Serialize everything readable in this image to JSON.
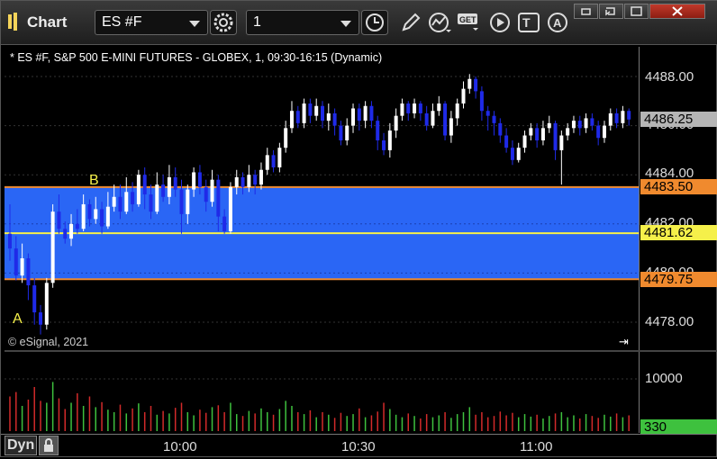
{
  "window": {
    "title": "Chart"
  },
  "toolbar": {
    "symbol": "ES #F",
    "interval": "1",
    "icons": [
      "settings-icon",
      "clock-icon",
      "pen-icon",
      "study-icon",
      "get-icon",
      "play-icon",
      "text-icon",
      "alert-icon"
    ]
  },
  "window_controls": [
    "restore-icon",
    "link-icon",
    "maximize-icon",
    "close-icon"
  ],
  "chart": {
    "title": "* ES #F, S&P 500 E-MINI FUTURES - GLOBEX, 1, 09:30-16:15 (Dynamic)",
    "copyright": "© eSignal, 2021",
    "annotations": {
      "a": "A",
      "b": "B"
    }
  },
  "chart_data": {
    "type": "candlestick",
    "y_ticks": [
      "4488.00",
      "4486.00",
      "4484.00",
      "4482.00",
      "4480.00",
      "4478.00"
    ],
    "price_labels": {
      "last": "4486.25",
      "upper": "4483.50",
      "mid": "4481.62",
      "lower": "4479.75"
    },
    "zone": {
      "upper": 4483.5,
      "lower": 4479.75,
      "mid": 4481.62
    },
    "volume_ticks": [
      "10000"
    ],
    "volume_last": "330",
    "x_ticks": [
      "10:00",
      "10:30",
      "11:00"
    ],
    "candles": [
      [
        4481.6,
        4481.0,
        4482.8,
        4480.5
      ],
      [
        4481.0,
        4479.9,
        4481.5,
        4479.7
      ],
      [
        4479.9,
        4480.6,
        4481.2,
        4479.6
      ],
      [
        4480.6,
        4479.5,
        4480.8,
        4478.9
      ],
      [
        4479.5,
        4478.4,
        4479.8,
        4477.9
      ],
      [
        4478.4,
        4477.9,
        4478.7,
        4477.5
      ],
      [
        4477.9,
        4479.6,
        4479.8,
        4477.7
      ],
      [
        4479.6,
        4482.5,
        4482.8,
        4479.4
      ],
      [
        4482.5,
        4481.8,
        4483.2,
        4481.6
      ],
      [
        4481.8,
        4481.4,
        4482.1,
        4481.2
      ],
      [
        4481.4,
        4482.0,
        4482.4,
        4481.1
      ],
      [
        4482.0,
        4481.8,
        4482.6,
        4481.6
      ],
      [
        4481.8,
        4482.8,
        4483.2,
        4481.7
      ],
      [
        4482.8,
        4482.2,
        4483.0,
        4481.9
      ],
      [
        4482.2,
        4482.6,
        4483.1,
        4482.0
      ],
      [
        4482.6,
        4481.9,
        4482.9,
        4481.6
      ],
      [
        4481.9,
        4482.7,
        4483.3,
        4481.8
      ],
      [
        4482.7,
        4483.1,
        4483.6,
        4482.5
      ],
      [
        4483.1,
        4482.5,
        4483.6,
        4482.2
      ],
      [
        4482.5,
        4483.3,
        4483.9,
        4482.4
      ],
      [
        4483.3,
        4482.8,
        4483.7,
        4482.5
      ],
      [
        4482.8,
        4484.0,
        4484.2,
        4482.7
      ],
      [
        4484.0,
        4483.2,
        4484.3,
        4482.6
      ],
      [
        4483.2,
        4482.5,
        4483.6,
        4482.2
      ],
      [
        4482.5,
        4483.6,
        4484.1,
        4482.4
      ],
      [
        4483.6,
        4483.1,
        4484.0,
        4482.9
      ],
      [
        4483.1,
        4483.9,
        4484.4,
        4482.8
      ],
      [
        4483.9,
        4483.4,
        4484.3,
        4483.1
      ],
      [
        4483.4,
        4482.4,
        4483.8,
        4481.6
      ],
      [
        4482.4,
        4483.4,
        4483.6,
        4482.0
      ],
      [
        4483.4,
        4484.1,
        4484.3,
        4483.1
      ],
      [
        4484.1,
        4483.5,
        4484.4,
        4483.2
      ],
      [
        4483.5,
        4482.9,
        4483.8,
        4482.5
      ],
      [
        4482.9,
        4483.8,
        4484.2,
        4482.7
      ],
      [
        4483.8,
        4482.3,
        4484.0,
        4481.7
      ],
      [
        4482.3,
        4481.7,
        4482.6,
        4481.6
      ],
      [
        4481.7,
        4483.5,
        4483.7,
        4481.6
      ],
      [
        4483.5,
        4483.9,
        4484.2,
        4483.2
      ],
      [
        4483.9,
        4483.5,
        4484.1,
        4483.2
      ],
      [
        4483.5,
        4484.0,
        4484.4,
        4483.3
      ],
      [
        4484.0,
        4483.6,
        4484.2,
        4483.2
      ],
      [
        4483.6,
        4484.2,
        4484.5,
        4483.4
      ],
      [
        4484.2,
        4484.8,
        4485.1,
        4484.0
      ],
      [
        4484.8,
        4484.3,
        4485.0,
        4484.1
      ],
      [
        4484.3,
        4485.1,
        4485.3,
        4484.1
      ],
      [
        4485.1,
        4485.9,
        4486.2,
        4484.9
      ],
      [
        4485.9,
        4486.6,
        4487.0,
        4485.7
      ],
      [
        4486.6,
        4486.1,
        4486.8,
        4485.9
      ],
      [
        4486.1,
        4486.9,
        4487.1,
        4485.9
      ],
      [
        4486.9,
        4486.4,
        4487.1,
        4486.1
      ],
      [
        4486.4,
        4486.8,
        4487.1,
        4486.2
      ],
      [
        4486.8,
        4486.2,
        4487.0,
        4485.9
      ],
      [
        4486.2,
        4486.5,
        4486.9,
        4485.8
      ],
      [
        4486.5,
        4486.0,
        4486.7,
        4485.6
      ],
      [
        4486.0,
        4485.4,
        4486.2,
        4485.2
      ],
      [
        4485.4,
        4486.0,
        4486.3,
        4485.2
      ],
      [
        4486.0,
        4486.7,
        4486.9,
        4485.7
      ],
      [
        4486.7,
        4486.2,
        4486.9,
        4485.8
      ],
      [
        4486.2,
        4486.8,
        4487.0,
        4485.9
      ],
      [
        4486.8,
        4486.2,
        4487.0,
        4485.9
      ],
      [
        4486.2,
        4485.4,
        4486.4,
        4485.0
      ],
      [
        4485.4,
        4485.0,
        4485.7,
        4484.8
      ],
      [
        4485.0,
        4485.8,
        4486.1,
        4484.7
      ],
      [
        4485.8,
        4486.4,
        4486.7,
        4485.5
      ],
      [
        4486.4,
        4486.9,
        4487.1,
        4486.2
      ],
      [
        4486.9,
        4486.5,
        4487.0,
        4486.2
      ],
      [
        4486.5,
        4486.9,
        4487.1,
        4486.3
      ],
      [
        4486.9,
        4486.5,
        4487.0,
        4486.2
      ],
      [
        4486.5,
        4486.0,
        4486.8,
        4485.8
      ],
      [
        4486.0,
        4486.6,
        4486.9,
        4485.9
      ],
      [
        4486.6,
        4486.9,
        4487.2,
        4486.4
      ],
      [
        4486.9,
        4485.6,
        4487.0,
        4485.4
      ],
      [
        4485.6,
        4486.3,
        4486.6,
        4485.3
      ],
      [
        4486.3,
        4486.9,
        4487.1,
        4486.0
      ],
      [
        4486.9,
        4487.5,
        4487.8,
        4486.7
      ],
      [
        4487.5,
        4487.9,
        4488.1,
        4487.3
      ],
      [
        4487.9,
        4487.4,
        4488.0,
        4487.1
      ],
      [
        4487.4,
        4486.6,
        4487.6,
        4486.2
      ],
      [
        4486.6,
        4486.4,
        4486.8,
        4485.8
      ],
      [
        4486.4,
        4486.1,
        4486.6,
        4485.6
      ],
      [
        4486.1,
        4485.6,
        4486.3,
        4485.3
      ],
      [
        4485.6,
        4485.1,
        4485.9,
        4484.9
      ],
      [
        4485.1,
        4484.6,
        4485.4,
        4484.4
      ],
      [
        4484.6,
        4485.1,
        4485.3,
        4484.5
      ],
      [
        4485.1,
        4485.6,
        4485.8,
        4484.9
      ],
      [
        4485.6,
        4485.9,
        4486.1,
        4485.4
      ],
      [
        4485.9,
        4485.4,
        4486.1,
        4485.1
      ],
      [
        4485.4,
        4485.9,
        4486.2,
        4485.2
      ],
      [
        4485.9,
        4486.1,
        4486.4,
        4485.7
      ],
      [
        4486.1,
        4485.0,
        4486.2,
        4484.6
      ],
      [
        4485.0,
        4485.6,
        4485.8,
        4483.6
      ],
      [
        4485.6,
        4485.9,
        4486.1,
        4485.4
      ],
      [
        4485.9,
        4486.2,
        4486.4,
        4485.7
      ],
      [
        4486.2,
        4485.9,
        4486.4,
        4485.6
      ],
      [
        4485.9,
        4486.3,
        4486.5,
        4485.7
      ],
      [
        4486.3,
        4486.0,
        4486.5,
        4485.8
      ],
      [
        4486.0,
        4485.5,
        4486.2,
        4485.2
      ],
      [
        4485.5,
        4486.0,
        4486.2,
        4485.3
      ],
      [
        4486.0,
        4486.5,
        4486.7,
        4485.8
      ],
      [
        4486.5,
        4486.1,
        4486.7,
        4485.9
      ],
      [
        4486.1,
        4486.6,
        4486.8,
        4485.9
      ],
      [
        4486.6,
        4486.25,
        4486.7,
        4486.0
      ]
    ],
    "volumes": [
      0.55,
      0.62,
      0.4,
      0.5,
      0.7,
      0.48,
      0.45,
      0.78,
      0.52,
      0.35,
      0.45,
      0.6,
      0.4,
      0.55,
      0.38,
      0.46,
      0.34,
      0.3,
      0.42,
      0.28,
      0.36,
      0.44,
      0.3,
      0.4,
      0.26,
      0.32,
      0.28,
      0.37,
      0.45,
      0.3,
      0.25,
      0.34,
      0.29,
      0.38,
      0.41,
      0.3,
      0.45,
      0.27,
      0.24,
      0.32,
      0.28,
      0.36,
      0.3,
      0.26,
      0.35,
      0.48,
      0.4,
      0.3,
      0.27,
      0.33,
      0.22,
      0.3,
      0.26,
      0.21,
      0.29,
      0.24,
      0.27,
      0.36,
      0.22,
      0.25,
      0.31,
      0.45,
      0.35,
      0.26,
      0.22,
      0.28,
      0.24,
      0.2,
      0.27,
      0.22,
      0.25,
      0.3,
      0.21,
      0.27,
      0.3,
      0.38,
      0.26,
      0.3,
      0.22,
      0.24,
      0.31,
      0.25,
      0.29,
      0.22,
      0.27,
      0.23,
      0.26,
      0.2,
      0.24,
      0.28,
      0.3,
      0.22,
      0.25,
      0.2,
      0.27,
      0.24,
      0.21,
      0.26,
      0.23,
      0.28,
      0.22,
      0.25
    ]
  },
  "status_bar": {
    "mode": "Dyn"
  }
}
